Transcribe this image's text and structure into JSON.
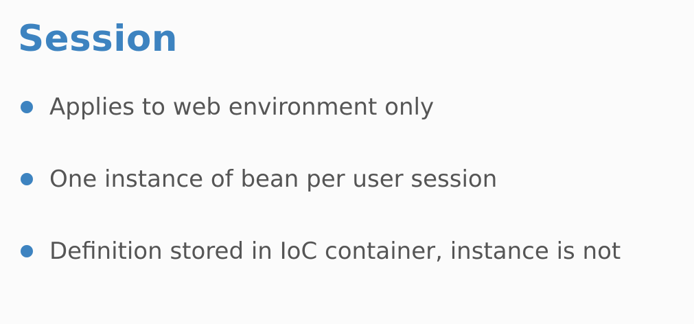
{
  "slide": {
    "title": "Session",
    "accent_color": "#3d83c0",
    "text_color": "#555555",
    "bullets": [
      {
        "text": "Applies to web environment only"
      },
      {
        "text": "One instance of bean per user session"
      },
      {
        "text": "Definition stored in IoC container, instance is not"
      }
    ]
  }
}
